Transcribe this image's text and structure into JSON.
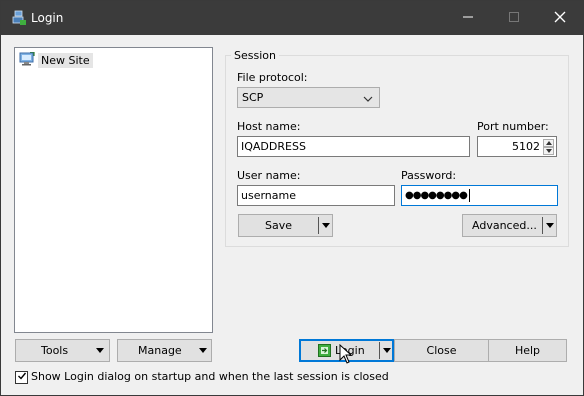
{
  "window": {
    "title": "Login",
    "icon": "winscp-login-icon",
    "controls": {
      "minimize": "minimize-icon",
      "maximize": "maximize-icon",
      "close": "close-icon"
    }
  },
  "sites": {
    "items": [
      {
        "label": "New Site",
        "icon": "computer-icon"
      }
    ]
  },
  "session": {
    "group_title": "Session",
    "file_protocol_label": "File protocol:",
    "file_protocol_value": "SCP",
    "host_name_label": "Host name:",
    "host_name_value": "IQADDRESS",
    "port_number_label": "Port number:",
    "port_number_value": "5102",
    "user_name_label": "User name:",
    "user_name_value": "username",
    "password_label": "Password:",
    "password_value": "●●●●●●●●",
    "save_label": "Save",
    "advanced_label": "Advanced..."
  },
  "footer": {
    "tools_label": "Tools",
    "manage_label": "Manage",
    "login_label": "Login",
    "close_label": "Close",
    "help_label": "Help",
    "show_login_checkbox_checked": true,
    "show_login_label": "Show Login dialog on startup and when the last session is closed"
  },
  "colors": {
    "titlebar": "#3b3b3b",
    "focus_border": "#0078d7",
    "button_bg": "#e1e1e1",
    "window_bg": "#f0f0f0"
  }
}
